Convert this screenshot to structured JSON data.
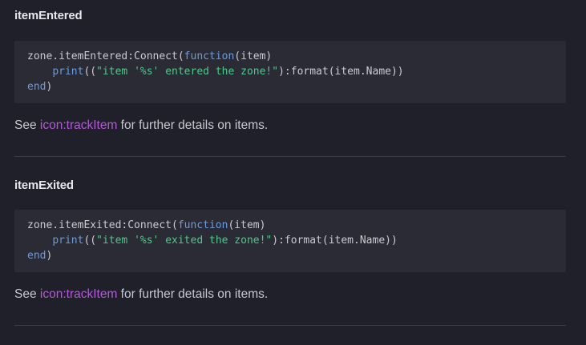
{
  "sections": [
    {
      "title": "itemEntered",
      "code": {
        "line1": {
          "obj": "zone.itemEntered:Connect(",
          "kw_function": "function",
          "args": "(item)"
        },
        "line2": {
          "indent": "    ",
          "print_kw": "print",
          "open": "((",
          "string": "\"item '%s' entered the zone!\"",
          "rest": "):format(item.Name))"
        },
        "line3": {
          "kw_end": "end",
          "close": ")"
        }
      },
      "desc_prefix": "See ",
      "link_text": "icon:trackItem",
      "desc_suffix": " for further details on items."
    },
    {
      "title": "itemExited",
      "code": {
        "line1": {
          "obj": "zone.itemExited:Connect(",
          "kw_function": "function",
          "args": "(item)"
        },
        "line2": {
          "indent": "    ",
          "print_kw": "print",
          "open": "((",
          "string": "\"item '%s' exited the zone!\"",
          "rest": "):format(item.Name))"
        },
        "line3": {
          "kw_end": "end",
          "close": ")"
        }
      },
      "desc_prefix": "See ",
      "link_text": "icon:trackItem",
      "desc_suffix": " for further details on items."
    }
  ],
  "colors": {
    "background": "#1f2029",
    "code_background": "#2a2b35",
    "keyword": "#6b9bdc",
    "string": "#4ec98a",
    "link": "#b15bd6"
  }
}
